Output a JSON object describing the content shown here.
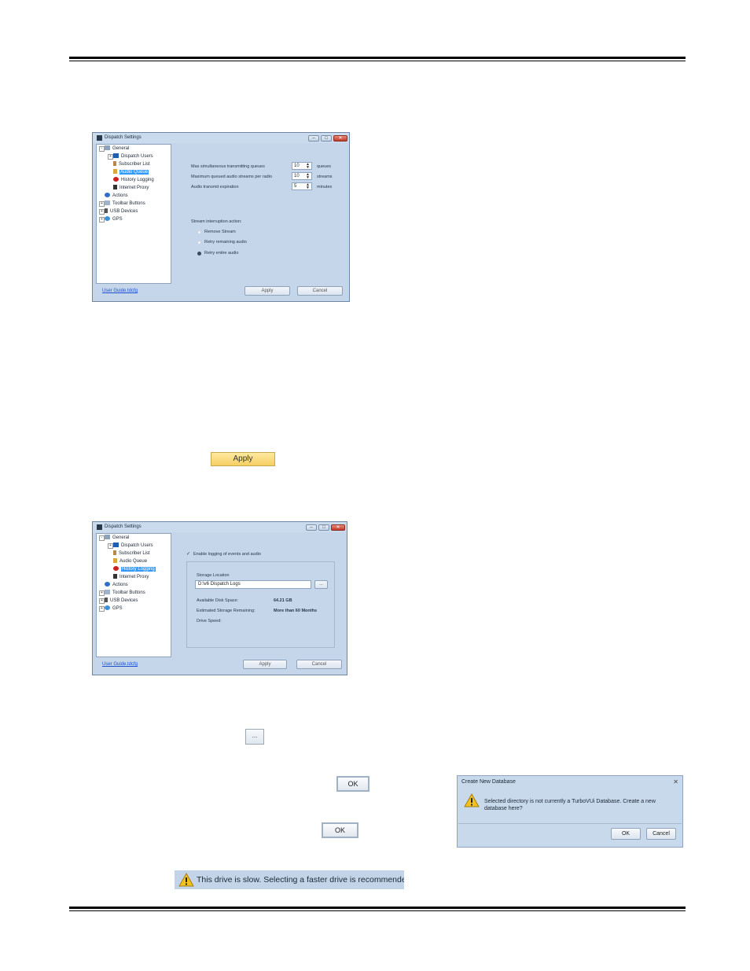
{
  "dialog1": {
    "title": "Dispatch Settings",
    "tree": [
      "General",
      "Dispatch Users",
      "Subscriber List",
      "Audio Queue",
      "History Logging",
      "Internet Proxy",
      "Actions",
      "Toolbar Buttons",
      "USB Devices",
      "GPS"
    ],
    "selected": "Audio Queue",
    "fields": [
      {
        "label": "Max simultaneous transmitting queues",
        "value": "10",
        "unit": "queues"
      },
      {
        "label": "Maximum queued audio streams per radio",
        "value": "10",
        "unit": "streams"
      },
      {
        "label": "Audio transmit expiration",
        "value": "5",
        "unit": "minutes"
      }
    ],
    "interruption_label": "Stream interruption action:",
    "radios": [
      {
        "label": "Remove Stream",
        "checked": false
      },
      {
        "label": "Retry remaining audio",
        "checked": false
      },
      {
        "label": "Retry entire audio",
        "checked": true
      }
    ],
    "link": "User Guide.tdcfg",
    "apply": "Apply",
    "cancel": "Cancel"
  },
  "apply_button": "Apply",
  "dialog2": {
    "title": "Dispatch Settings",
    "tree": [
      "General",
      "Dispatch Users",
      "Subscriber List",
      "Audio Queue",
      "History Logging",
      "Internet Proxy",
      "Actions",
      "Toolbar Buttons",
      "USB Devices",
      "GPS"
    ],
    "selected": "History Logging",
    "enable_label": "Enable logging of events and audio",
    "storage_label": "Storage Location",
    "storage_value": "D:\\v6 Dispatch Logs",
    "browse": "...",
    "stats": [
      {
        "label": "Available Disk Space:",
        "value": "64.21 GB"
      },
      {
        "label": "Estimated Storage Remaining:",
        "value": "More than 60 Months"
      },
      {
        "label": "Drive Speed:",
        "value": ""
      }
    ],
    "link": "User Guide.tdcfg",
    "apply": "Apply",
    "cancel": "Cancel"
  },
  "browse_button": "...",
  "ok_button_1": "OK",
  "ok_button_2": "OK",
  "create_db": {
    "title": "Create New Database",
    "message": "Selected directory is not currently a TurboVUi Database. Create a new database here?",
    "ok": "OK",
    "cancel": "Cancel"
  },
  "warning_bar": "This drive is slow. Selecting a faster drive is recommended."
}
